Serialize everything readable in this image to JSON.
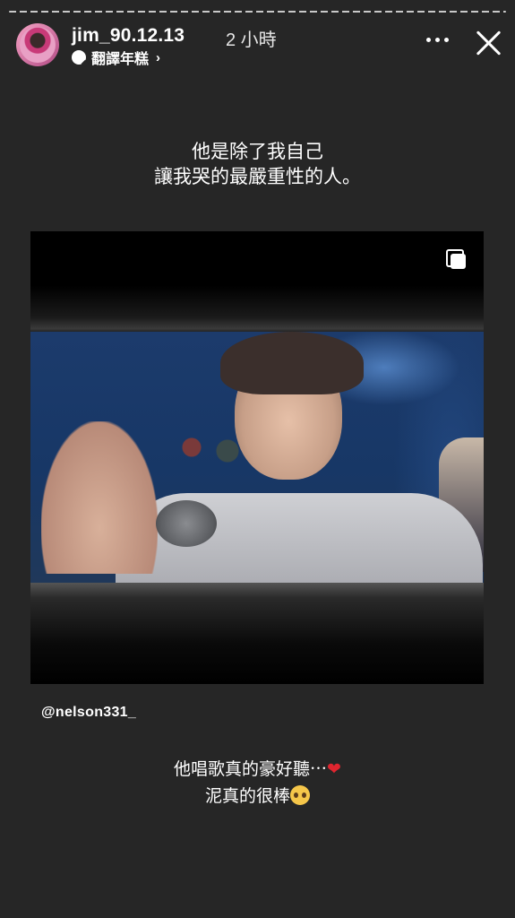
{
  "progress": {
    "segments": 1,
    "current_fraction": 0.0
  },
  "header": {
    "username": "jim_90.12.13",
    "time_ago": "2 小時",
    "audio_label": "翻譯年糕",
    "audio_icon": "audio-bubble-icon",
    "chevron": "›",
    "more_icon": "more-horizontal-icon",
    "close_icon": "close-icon"
  },
  "story": {
    "caption_top_line1": "他是除了我自己",
    "caption_top_line2": "讓我哭的最嚴重性的人。",
    "media_icon": "multiple-posts-icon",
    "mention": "@nelson331_",
    "caption_bottom_line1": "他唱歌真的豪好聽⋯",
    "caption_bottom_heart": "❤",
    "caption_bottom_line2": "泥真的很棒",
    "caption_bottom_emoji": "pleading-face-emoji"
  },
  "colors": {
    "background": "#262626",
    "heart": "#e0252f"
  }
}
